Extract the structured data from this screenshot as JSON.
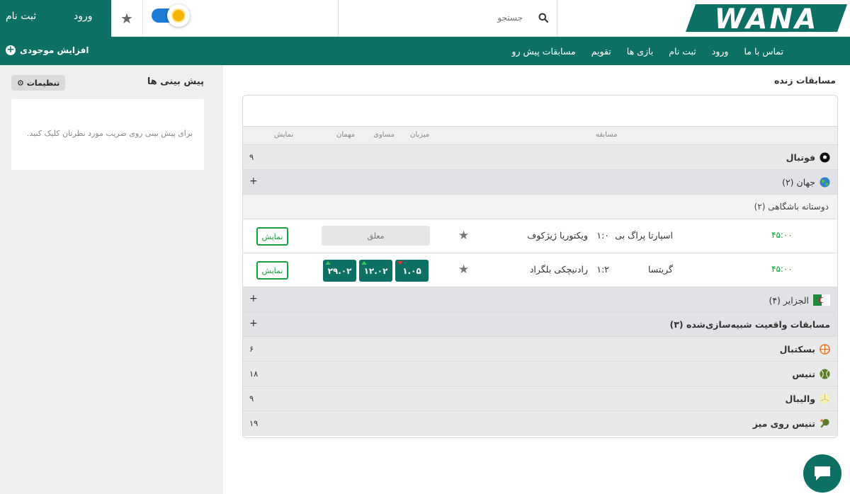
{
  "header": {
    "login": "ورود",
    "register": "ثبت نام",
    "search_placeholder": "جستجو",
    "logo_text": "WANA"
  },
  "nav": {
    "items": [
      "مسابقات پیش رو",
      "تقویم",
      "بازی ها",
      "ثبت نام",
      "ورود",
      "تماس با ما"
    ],
    "topup": "افزایش موجودی"
  },
  "sidebar": {
    "title": "پیش بینی ها",
    "settings": "تنظیمات",
    "empty_message": "برای پیش بینی روی ضریب مورد نظرتان کلیک کنید."
  },
  "main": {
    "title": "مسابقات زنده",
    "columns": {
      "match": "مسابقه",
      "home": "میزبان",
      "draw": "مساوی",
      "away": "مهمان",
      "show": "نمایش"
    },
    "football": {
      "label": "فوتبال",
      "count": "۹"
    },
    "world": {
      "label": "جهان (۲)",
      "toggle": "+"
    },
    "league": {
      "label": "دوستانه باشگاهی (۲)"
    },
    "matches": [
      {
        "time": "۴۵:۰۰",
        "home": "اسپارتا پراگ بی",
        "score": "۱:۰",
        "away": "ویکتوریا ژیژکوف",
        "locked_label": "معلق",
        "show": "نمایش"
      },
      {
        "time": "۴۵:۰۰",
        "home": "گریتسا",
        "score": "۱:۲",
        "away": "رادنیچکی بلگراد",
        "odds": [
          "۱.۰۵",
          "۱۲.۰۲",
          "۲۹.۰۲"
        ],
        "show": "نمایش"
      }
    ],
    "algeria": {
      "label": "الجزایر (۴)",
      "toggle": "+"
    },
    "simulated": {
      "label": "مسابقات واقعیت شبیه‌سازی‌شده (۳)",
      "toggle": "+"
    },
    "sports": [
      {
        "label": "بسکتبال",
        "count": "۶"
      },
      {
        "label": "تنیس",
        "count": "۱۸"
      },
      {
        "label": "والیبال",
        "count": "۹"
      },
      {
        "label": "تنیس روی میز",
        "count": "۱۹"
      }
    ]
  },
  "colors": {
    "brand": "#0c7064",
    "accent_green": "#15a33e",
    "toggle_blue": "#1e7bd6"
  }
}
